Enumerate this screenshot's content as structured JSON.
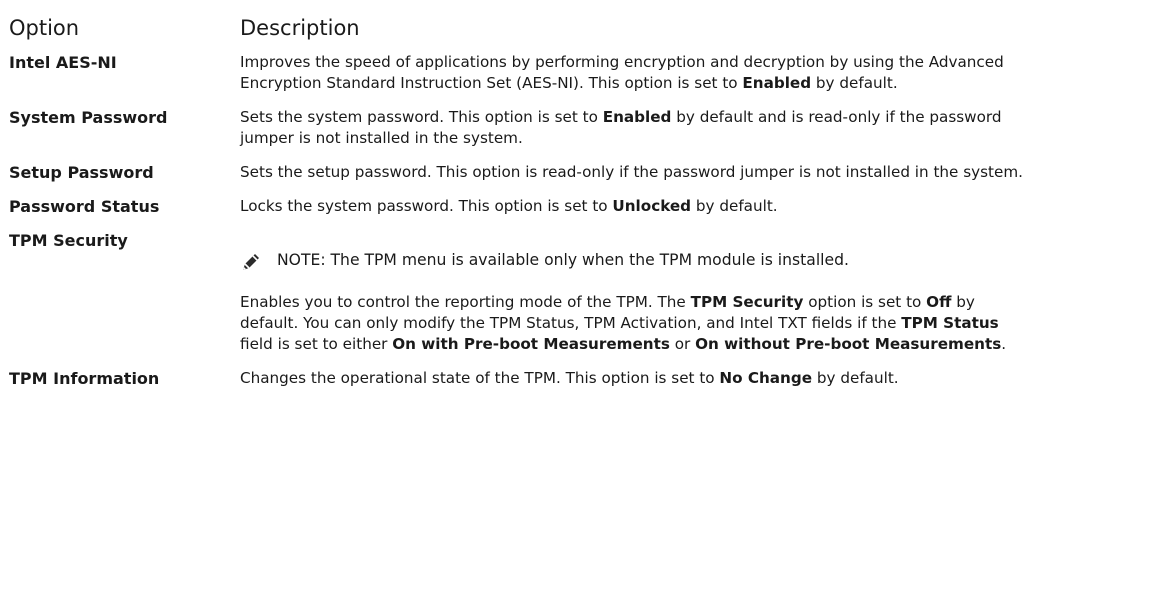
{
  "header": {
    "option_label": "Option",
    "description_label": "Description"
  },
  "rows": [
    {
      "name": "Intel AES-NI",
      "desc": [
        {
          "t": "Improves the speed of applications by performing encryption and decryption by using the Advanced Encryption Standard Instruction Set (AES-NI). This option is set to ",
          "b": false
        },
        {
          "t": "Enabled",
          "b": true
        },
        {
          "t": " by default.",
          "b": false
        }
      ]
    },
    {
      "name": "System Password",
      "desc": [
        {
          "t": "Sets the system password. This option is set to ",
          "b": false
        },
        {
          "t": "Enabled",
          "b": true
        },
        {
          "t": " by default and is read-only if the password jumper is not installed in the system.",
          "b": false
        }
      ]
    },
    {
      "name": "Setup Password",
      "desc": [
        {
          "t": "Sets the setup password. This option is read-only if the password jumper is not installed in the system.",
          "b": false
        }
      ]
    },
    {
      "name": "Password Status",
      "desc": [
        {
          "t": "Locks the system password. This option is set to ",
          "b": false
        },
        {
          "t": "Unlocked",
          "b": true
        },
        {
          "t": " by default.",
          "b": false
        }
      ]
    },
    {
      "name": "TPM Security",
      "note": {
        "label": "NOTE:",
        "text": " The TPM menu is available only when the TPM module is installed.",
        "icon": "note-pencil-icon"
      },
      "desc": [
        {
          "t": "Enables you to control the reporting mode of the TPM. The ",
          "b": false
        },
        {
          "t": "TPM Security",
          "b": true
        },
        {
          "t": " option is set to ",
          "b": false
        },
        {
          "t": "Off",
          "b": true
        },
        {
          "t": " by default. You can only modify the TPM Status, TPM Activation, and Intel TXT fields if the ",
          "b": false
        },
        {
          "t": "TPM Status",
          "b": true
        },
        {
          "t": " field is set to either ",
          "b": false
        },
        {
          "t": "On with Pre-boot Measurements",
          "b": true
        },
        {
          "t": " or ",
          "b": false
        },
        {
          "t": "On without Pre-boot Measurements",
          "b": true
        },
        {
          "t": ".",
          "b": false
        }
      ]
    },
    {
      "name": "TPM Information",
      "desc": [
        {
          "t": "Changes the operational state of the TPM. This option is set to ",
          "b": false
        },
        {
          "t": "No Change",
          "b": true
        },
        {
          "t": " by default.",
          "b": false
        }
      ]
    }
  ]
}
